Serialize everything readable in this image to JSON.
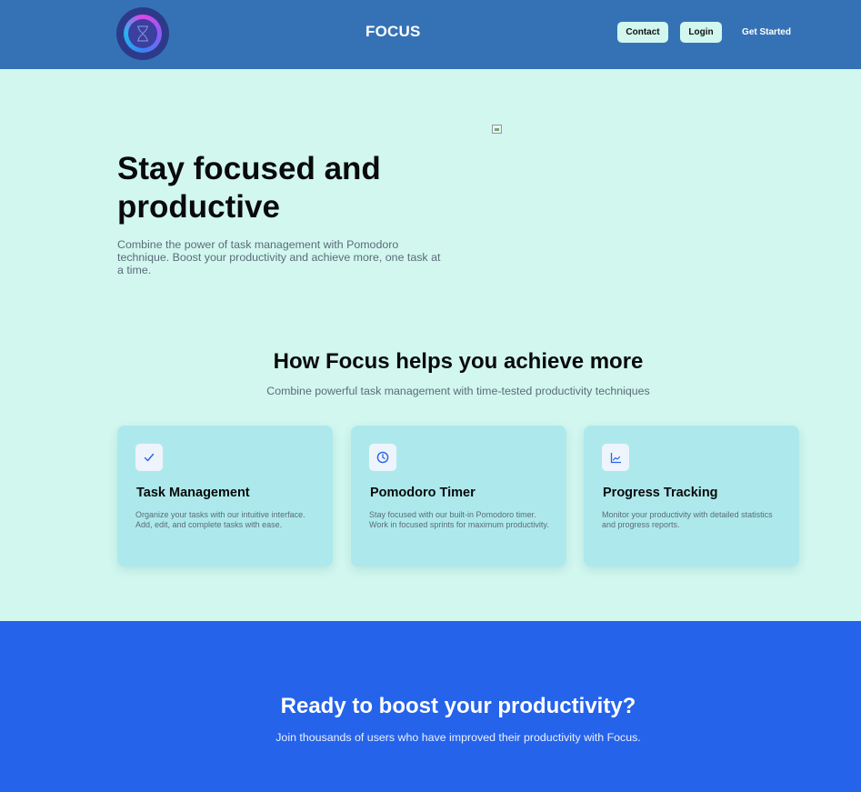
{
  "header": {
    "brand": "FOCUS",
    "nav": {
      "contact": "Contact",
      "login": "Login",
      "get_started": "Get Started"
    }
  },
  "hero": {
    "title": "Stay focused and productive",
    "subtitle": "Combine the power of task management with Pomodoro technique. Boost your productivity and achieve more, one task at a time."
  },
  "features": {
    "title": "How Focus helps you achieve more",
    "subtitle": "Combine powerful task management with time-tested productivity techniques",
    "cards": [
      {
        "icon": "check-icon",
        "title": "Task Management",
        "description": "Organize your tasks with our intuitive interface. Add, edit, and complete tasks with ease."
      },
      {
        "icon": "clock-icon",
        "title": "Pomodoro Timer",
        "description": "Stay focused with our built-in Pomodoro timer. Work in focused sprints for maximum productivity."
      },
      {
        "icon": "chart-icon",
        "title": "Progress Tracking",
        "description": "Monitor your productivity with detailed statistics and progress reports."
      }
    ]
  },
  "cta": {
    "title": "Ready to boost your productivity?",
    "subtitle": "Join thousands of users who have improved their productivity with Focus."
  },
  "colors": {
    "header_bg": "#3572b5",
    "page_bg": "#d1f7ef",
    "card_bg": "#ade9ec",
    "cta_bg": "#2563eb",
    "icon_accent": "#2563eb"
  }
}
